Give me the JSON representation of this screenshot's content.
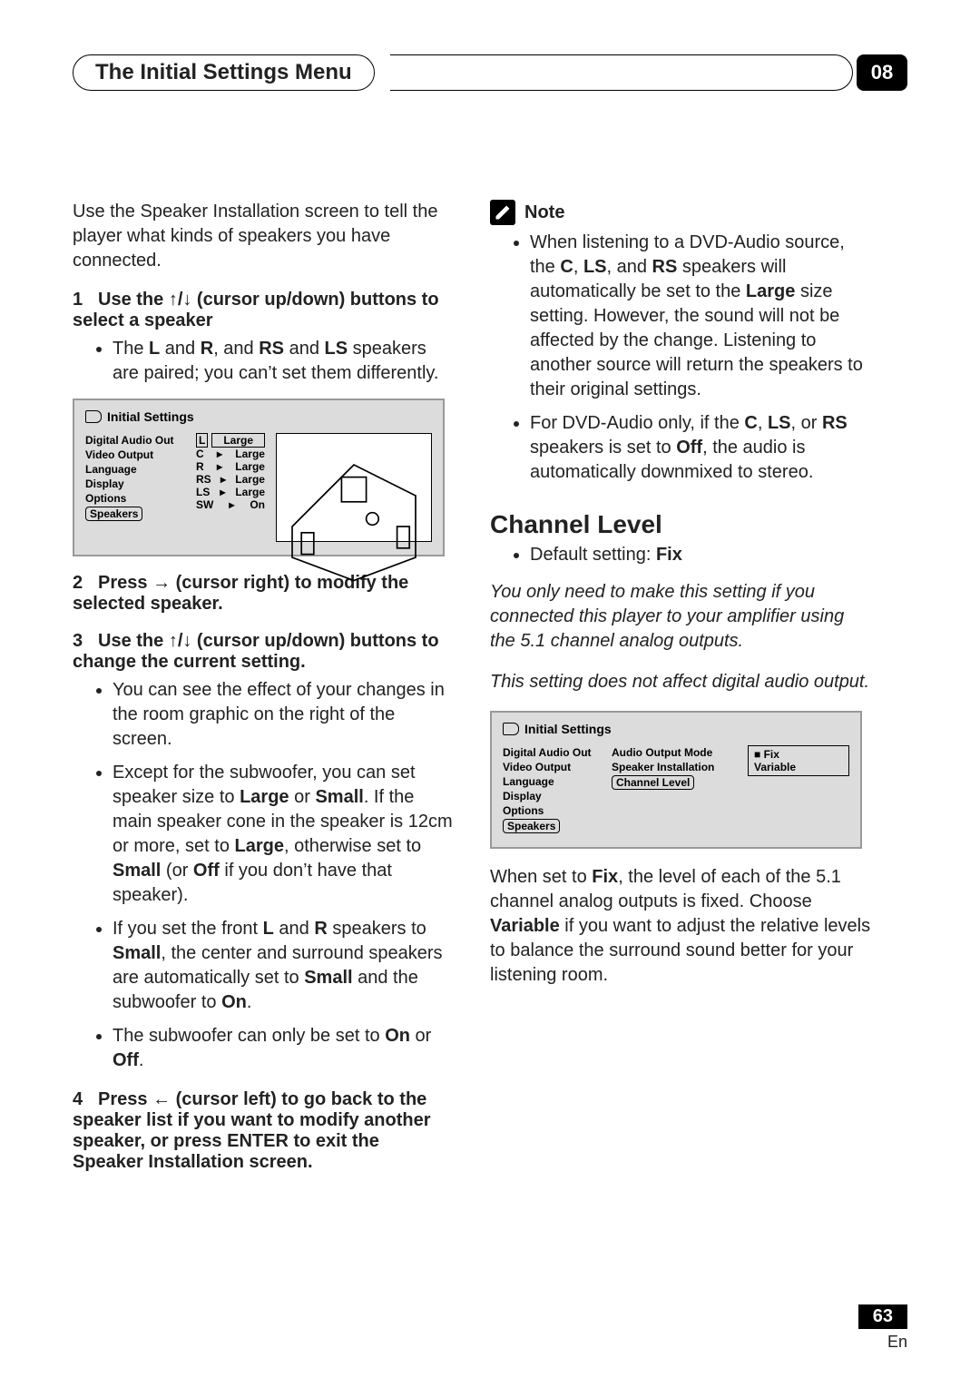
{
  "header": {
    "title": "The Initial Settings Menu",
    "chapter": "08"
  },
  "leftcol": {
    "intro": "Use the Speaker Installation screen to tell the player what kinds of speakers you have connected.",
    "step1": {
      "num": "1",
      "text_pre": "Use the ",
      "arrows": "↑/↓",
      "text_mid": " (cursor up/down) buttons to select a speaker"
    },
    "step1_b1_pre": "The ",
    "step1_b1_L": "L",
    "step1_b1_and1": " and ",
    "step1_b1_R": "R",
    "step1_b1_and2": ", and ",
    "step1_b1_RS": "RS",
    "step1_b1_and3": " and ",
    "step1_b1_LS": "LS",
    "step1_b1_post": " speakers are paired; you can’t set them differently.",
    "step2": {
      "num": "2",
      "text_pre": "Press ",
      "arrow": "→",
      "text_post": " (cursor right) to modify the selected speaker."
    },
    "step3": {
      "num": "3",
      "text_pre": "Use the ",
      "arrows": "↑/↓",
      "text_post": " (cursor up/down) buttons to change the current setting."
    },
    "s3b1": "You can see the effect of your changes in the room graphic on the right of the screen.",
    "s3b2_pre": "Except for the subwoofer, you can set speaker size to ",
    "s3b2_Large": "Large",
    "s3b2_or": " or ",
    "s3b2_Small": "Small",
    "s3b2_mid": ". If the main speaker cone in the speaker is 12cm or more, set to ",
    "s3b2_Large2": "Large",
    "s3b2_mid2": ", otherwise set to ",
    "s3b2_Small2": "Small",
    "s3b2_par": " (or ",
    "s3b2_Off": "Off",
    "s3b2_post": " if you don’t have that speaker).",
    "s3b3_pre": "If you set the front ",
    "s3b3_L": "L",
    "s3b3_and": " and ",
    "s3b3_R": "R",
    "s3b3_mid": " speakers to ",
    "s3b3_Small": "Small",
    "s3b3_mid2": ", the center and surround speakers are automatically set to ",
    "s3b3_Small2": "Small",
    "s3b3_mid3": " and the subwoofer to ",
    "s3b3_On": "On",
    "s3b3_post": ".",
    "s3b4_pre": "The subwoofer can only be set to ",
    "s3b4_On": "On",
    "s3b4_or": " or ",
    "s3b4_Off": "Off",
    "s3b4_post": ".",
    "step4": {
      "num": "4",
      "text_pre": "Press ",
      "arrow": "←",
      "text_post": " (cursor left) to go back to the speaker list if you want to modify another speaker, or press ENTER to exit the Speaker Installation screen."
    }
  },
  "rightcol": {
    "note_label": "Note",
    "n1_pre": "When listening to a DVD-Audio source, the ",
    "n1_C": "C",
    "n1_c1": ", ",
    "n1_LS": "LS",
    "n1_c2": ", and ",
    "n1_RS": "RS",
    "n1_mid": " speakers will automatically be set to the ",
    "n1_Large": "Large",
    "n1_post": " size setting. However, the sound will not be affected by the change. Listening to another source will return the speakers to their original settings.",
    "n2_pre": "For DVD-Audio only, if the ",
    "n2_C": "C",
    "n2_c1": ", ",
    "n2_LS": "LS",
    "n2_c2": ", or ",
    "n2_RS": "RS",
    "n2_mid": " speakers is set to ",
    "n2_Off": "Off",
    "n2_post": ", the audio is automatically downmixed to stereo.",
    "sec_title": "Channel Level",
    "def_pre": "Default setting: ",
    "def_val": "Fix",
    "it1": "You only need to make this setting if you connected this player to your amplifier using the 5.1 channel analog outputs.",
    "it2": "This setting does not affect digital audio output.",
    "p_pre": "When set to ",
    "p_Fix": "Fix",
    "p_mid": ", the level of each of the 5.1 channel analog outputs is fixed. Choose ",
    "p_Var": "Variable",
    "p_post": " if you want to adjust the relative levels to balance the surround sound better for your listening room."
  },
  "osd_common": {
    "title": "Initial Settings",
    "nav": [
      "Digital Audio Out",
      "Video Output",
      "Language",
      "Display",
      "Options",
      "Speakers"
    ]
  },
  "osd_spk": {
    "rows": [
      {
        "ch": "L",
        "val": "Large",
        "boxed": true
      },
      {
        "ch": "C",
        "val": "Large"
      },
      {
        "ch": "R",
        "val": "Large"
      },
      {
        "ch": "RS",
        "val": "Large"
      },
      {
        "ch": "LS",
        "val": "Large"
      },
      {
        "ch": "SW",
        "val": "On"
      }
    ]
  },
  "osd_ch": {
    "sub": [
      "Audio Output Mode",
      "Speaker Installation",
      "Channel Level"
    ],
    "opts": [
      {
        "label": "Fix",
        "sel": true
      },
      {
        "label": "Variable",
        "sel": false
      }
    ]
  },
  "footer": {
    "page": "63",
    "lang": "En"
  }
}
